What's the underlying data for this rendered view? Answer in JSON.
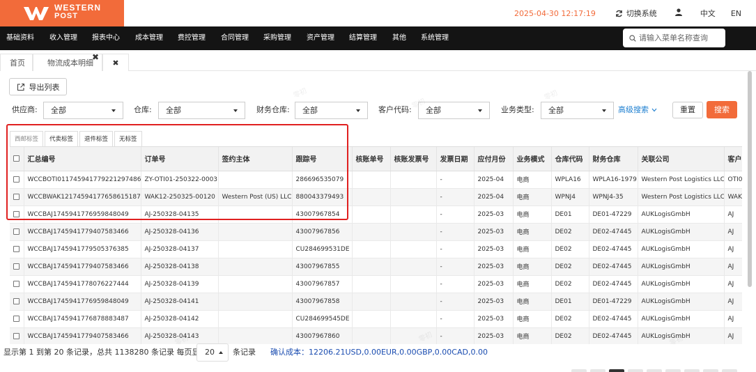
{
  "brand": {
    "name_line1": "WESTERN",
    "name_line2": "POST",
    "logo_color": "#f26b3a"
  },
  "topbar": {
    "datetime": "2025-04-30 12:17:19",
    "switch_label": "切换系统",
    "lang_zh": "中文",
    "lang_en": "EN"
  },
  "nav": {
    "items": [
      "基础资料",
      "收入管理",
      "报表中心",
      "成本管理",
      "费控管理",
      "合同管理",
      "采购管理",
      "资产管理",
      "结算管理",
      "其他",
      "系统管理"
    ],
    "search_placeholder": "请输入菜单名称查询"
  },
  "tabs": {
    "home": "首页",
    "current": "物流成本明细"
  },
  "toolbar": {
    "export_label": "导出列表"
  },
  "filters": {
    "supplier": {
      "label": "供应商:",
      "value": "全部"
    },
    "warehouse": {
      "label": "仓库:",
      "value": "全部"
    },
    "finance_warehouse": {
      "label": "财务仓库:",
      "value": "全部"
    },
    "customer_code": {
      "label": "客户代码:",
      "value": "全部"
    },
    "business_type": {
      "label": "业务类型:",
      "value": "全部"
    },
    "advanced": "高级搜索",
    "reset": "重置",
    "search": "搜索"
  },
  "label_tabs": [
    "西邮标签",
    "代卖标签",
    "退件标签",
    "无标签"
  ],
  "table": {
    "columns": [
      "汇总编号",
      "订单号",
      "签约主体",
      "跟踪号",
      "核账单号",
      "核账发票号",
      "发票日期",
      "应付月份",
      "业务模式",
      "仓库代码",
      "财务仓库",
      "关联公司",
      "客户"
    ],
    "rows": [
      [
        "WCCBOTI01174594177922129748​6",
        "ZY-OTI01-250322-0003",
        "",
        "286696535079",
        "",
        "",
        "-",
        "2025-04",
        "电商",
        "WPLA16",
        "WPLA16-1979",
        "Western Post Logistics LLC",
        "OTI0"
      ],
      [
        "WCCBWAK121745941776586151872",
        "WAK12-250325-00120",
        "Western Post (US) LLC",
        "880043379493",
        "",
        "",
        "-",
        "2025-04",
        "电商",
        "WPNJ4",
        "WPNJ4-35",
        "Western Post Logistics LLC",
        "WAK"
      ],
      [
        "WCCBAJ1745941776959848049",
        "AJ-250328-04135",
        "",
        "43007967854",
        "",
        "",
        "-",
        "2025-03",
        "电商",
        "DE01",
        "DE01-47229",
        "AUKLogisGmbH",
        "AJ"
      ],
      [
        "WCCBAJ1745941779407583466",
        "AJ-250328-04136",
        "",
        "43007967856",
        "",
        "",
        "-",
        "2025-03",
        "电商",
        "DE02",
        "DE02-47445",
        "AUKLogisGmbH",
        "AJ"
      ],
      [
        "WCCBAJ1745941779505376385",
        "AJ-250328-04137",
        "",
        "CU284699531DE",
        "",
        "",
        "-",
        "2025-03",
        "电商",
        "DE02",
        "DE02-47445",
        "AUKLogisGmbH",
        "AJ"
      ],
      [
        "WCCBAJ1745941779407583466",
        "AJ-250328-04138",
        "",
        "43007967855",
        "",
        "",
        "-",
        "2025-03",
        "电商",
        "DE02",
        "DE02-47445",
        "AUKLogisGmbH",
        "AJ"
      ],
      [
        "WCCBAJ1745941778076227444",
        "AJ-250328-04139",
        "",
        "43007967857",
        "",
        "",
        "-",
        "2025-03",
        "电商",
        "DE02",
        "DE02-47445",
        "AUKLogisGmbH",
        "AJ"
      ],
      [
        "WCCBAJ1745941776959848049",
        "AJ-250328-04141",
        "",
        "43007967858",
        "",
        "",
        "-",
        "2025-03",
        "电商",
        "DE01",
        "DE01-47229",
        "AUKLogisGmbH",
        "AJ"
      ],
      [
        "WCCBAJ1745941776878883487",
        "AJ-250328-04142",
        "",
        "CU284699545DE",
        "",
        "",
        "-",
        "2025-03",
        "电商",
        "DE02",
        "DE02-47445",
        "AUKLogisGmbH",
        "AJ"
      ],
      [
        "WCCBAJ1745941779407583466",
        "AJ-250328-04143",
        "",
        "43007967860",
        "",
        "",
        "-",
        "2025-03",
        "电商",
        "DE02",
        "DE02-47445",
        "AUKLogisGmbH",
        "AJ"
      ]
    ]
  },
  "footer": {
    "summary": "显示第 1 到第 20 条记录，总共 1138280 条记录 每页显示",
    "page_size": "20",
    "records_suffix": "条记录",
    "cost": "确认成本：12206.21USD,0.00EUR,0.00GBP,0.00CAD,0.00"
  },
  "watermark": "零初"
}
